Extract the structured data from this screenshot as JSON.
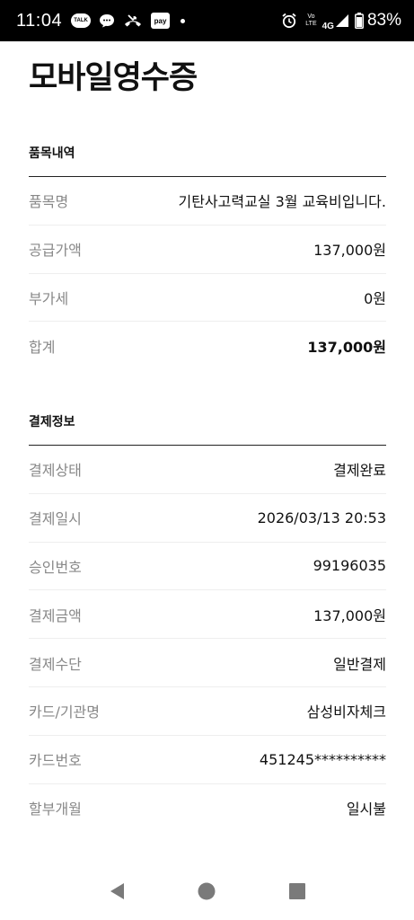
{
  "status_bar": {
    "time": "11:04",
    "talk_label": "TALK",
    "pay_label": "pay",
    "volte_top": "Vo",
    "volte_bottom": "LTE",
    "network": "4G",
    "battery": "83%"
  },
  "page_title": "모바일영수증",
  "items_section": {
    "title": "품목내역",
    "rows": [
      {
        "label": "품목명",
        "value": "기탄사고력교실 3월 교육비입니다."
      },
      {
        "label": "공급가액",
        "value": "137,000원"
      },
      {
        "label": "부가세",
        "value": "0원"
      },
      {
        "label": "합계",
        "value": "137,000원"
      }
    ]
  },
  "payment_section": {
    "title": "결제정보",
    "rows": [
      {
        "label": "결제상태",
        "value": "결제완료"
      },
      {
        "label": "결제일시",
        "value": "2026/03/13 20:53"
      },
      {
        "label": "승인번호",
        "value": "99196035"
      },
      {
        "label": "결제금액",
        "value": "137,000원"
      },
      {
        "label": "결제수단",
        "value": "일반결제"
      },
      {
        "label": "카드/기관명",
        "value": "삼성비자체크"
      },
      {
        "label": "카드번호",
        "value": "451245**********"
      },
      {
        "label": "할부개월",
        "value": "일시불"
      }
    ]
  },
  "nav_bar": {
    "icons": [
      "back-icon",
      "home-icon",
      "recents-icon"
    ],
    "color": "#7a7a7a"
  }
}
